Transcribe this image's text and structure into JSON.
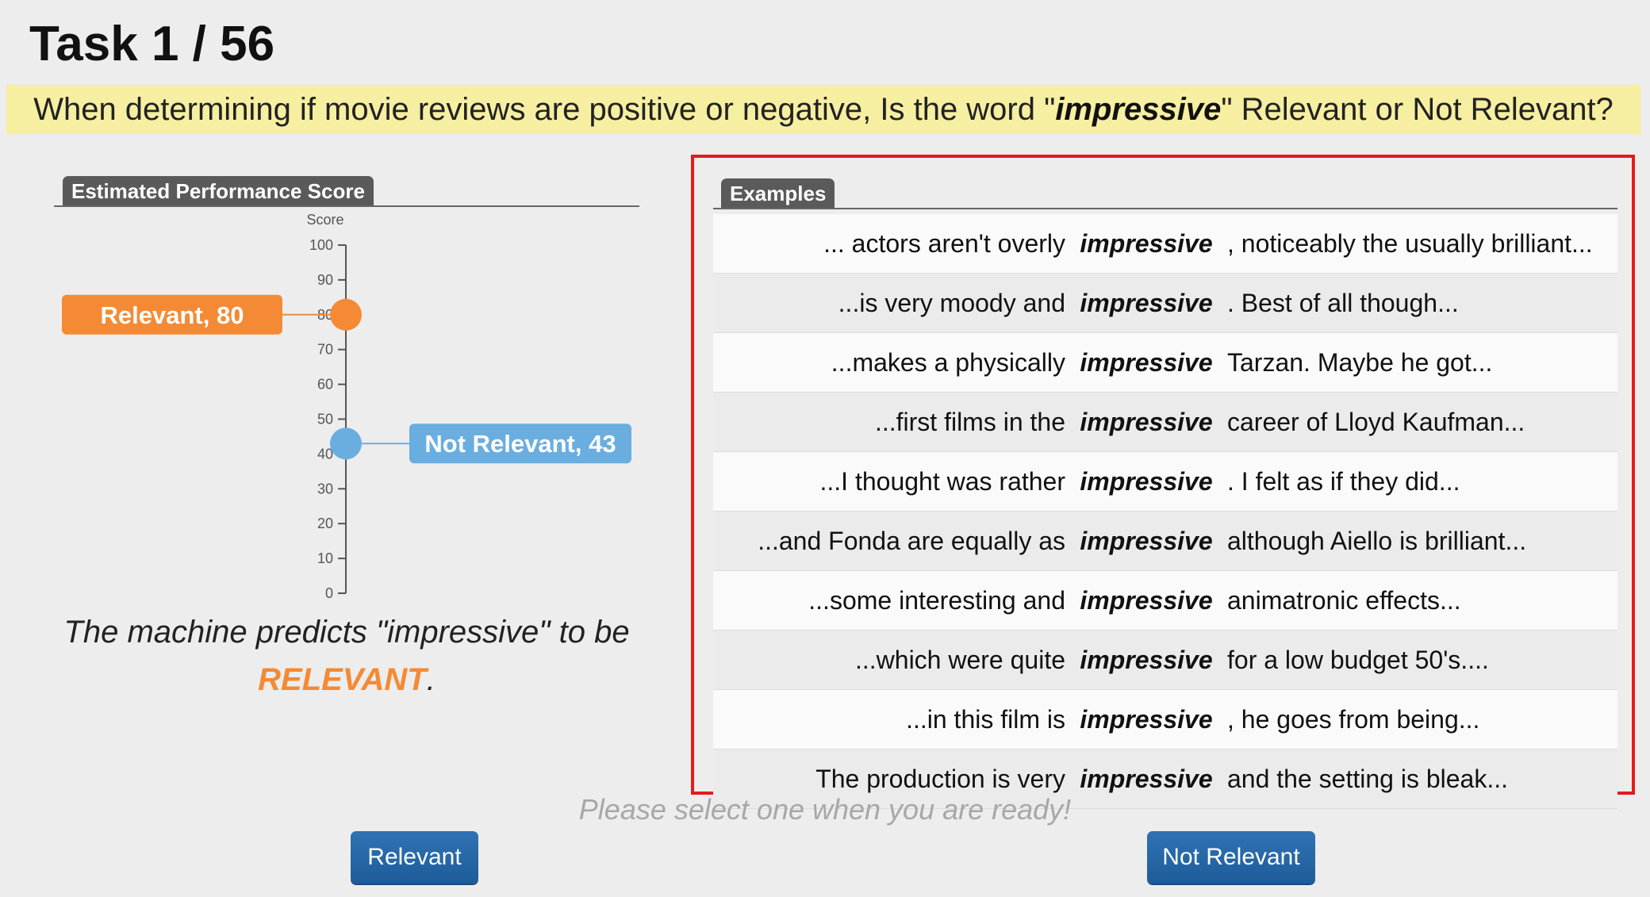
{
  "header": {
    "task_label": "Task 1 / 56"
  },
  "question": {
    "prefix": "When determining if movie reviews are positive or negative, Is the word \"",
    "keyword": "impressive",
    "suffix": "\" Relevant or Not Relevant?"
  },
  "score_panel": {
    "tab_label": "Estimated Performance Score",
    "axis_label": "Score",
    "ticks": [
      "100",
      "90",
      "80",
      "70",
      "60",
      "50",
      "40",
      "30",
      "20",
      "10",
      "0"
    ],
    "relevant": {
      "label": "Relevant, 80",
      "value": 80,
      "color": "#f58a35"
    },
    "not_relevant": {
      "label": "Not Relevant, 43",
      "value": 43,
      "color": "#6aaee0"
    }
  },
  "prediction": {
    "text": "The machine predicts \"impressive\" to be",
    "verdict": "RELEVANT",
    "period": "."
  },
  "examples": {
    "tab_label": "Examples",
    "rows": [
      {
        "left": "... actors aren't overly",
        "key": "impressive",
        "right": ", noticeably the usually brilliant..."
      },
      {
        "left": "...is very moody and",
        "key": "impressive",
        "right": ". Best of all though..."
      },
      {
        "left": "...makes a physically",
        "key": "impressive",
        "right": "Tarzan. Maybe he got..."
      },
      {
        "left": "...first films in the",
        "key": "impressive",
        "right": "career of Lloyd Kaufman..."
      },
      {
        "left": "...I thought was rather",
        "key": "impressive",
        "right": ". I felt as if they did..."
      },
      {
        "left": "...and Fonda are equally as",
        "key": "impressive",
        "right": "although Aiello is brilliant..."
      },
      {
        "left": "...some interesting and",
        "key": "impressive",
        "right": "animatronic effects..."
      },
      {
        "left": "...which were quite",
        "key": "impressive",
        "right": "for a low budget 50's...."
      },
      {
        "left": "...in this film is",
        "key": "impressive",
        "right": ", he goes from being..."
      },
      {
        "left": "The production is very",
        "key": "impressive",
        "right": "and the setting is bleak..."
      }
    ]
  },
  "footer": {
    "prompt": "Please select one when you are ready!",
    "relevant_button": "Relevant",
    "not_relevant_button": "Not Relevant"
  }
}
